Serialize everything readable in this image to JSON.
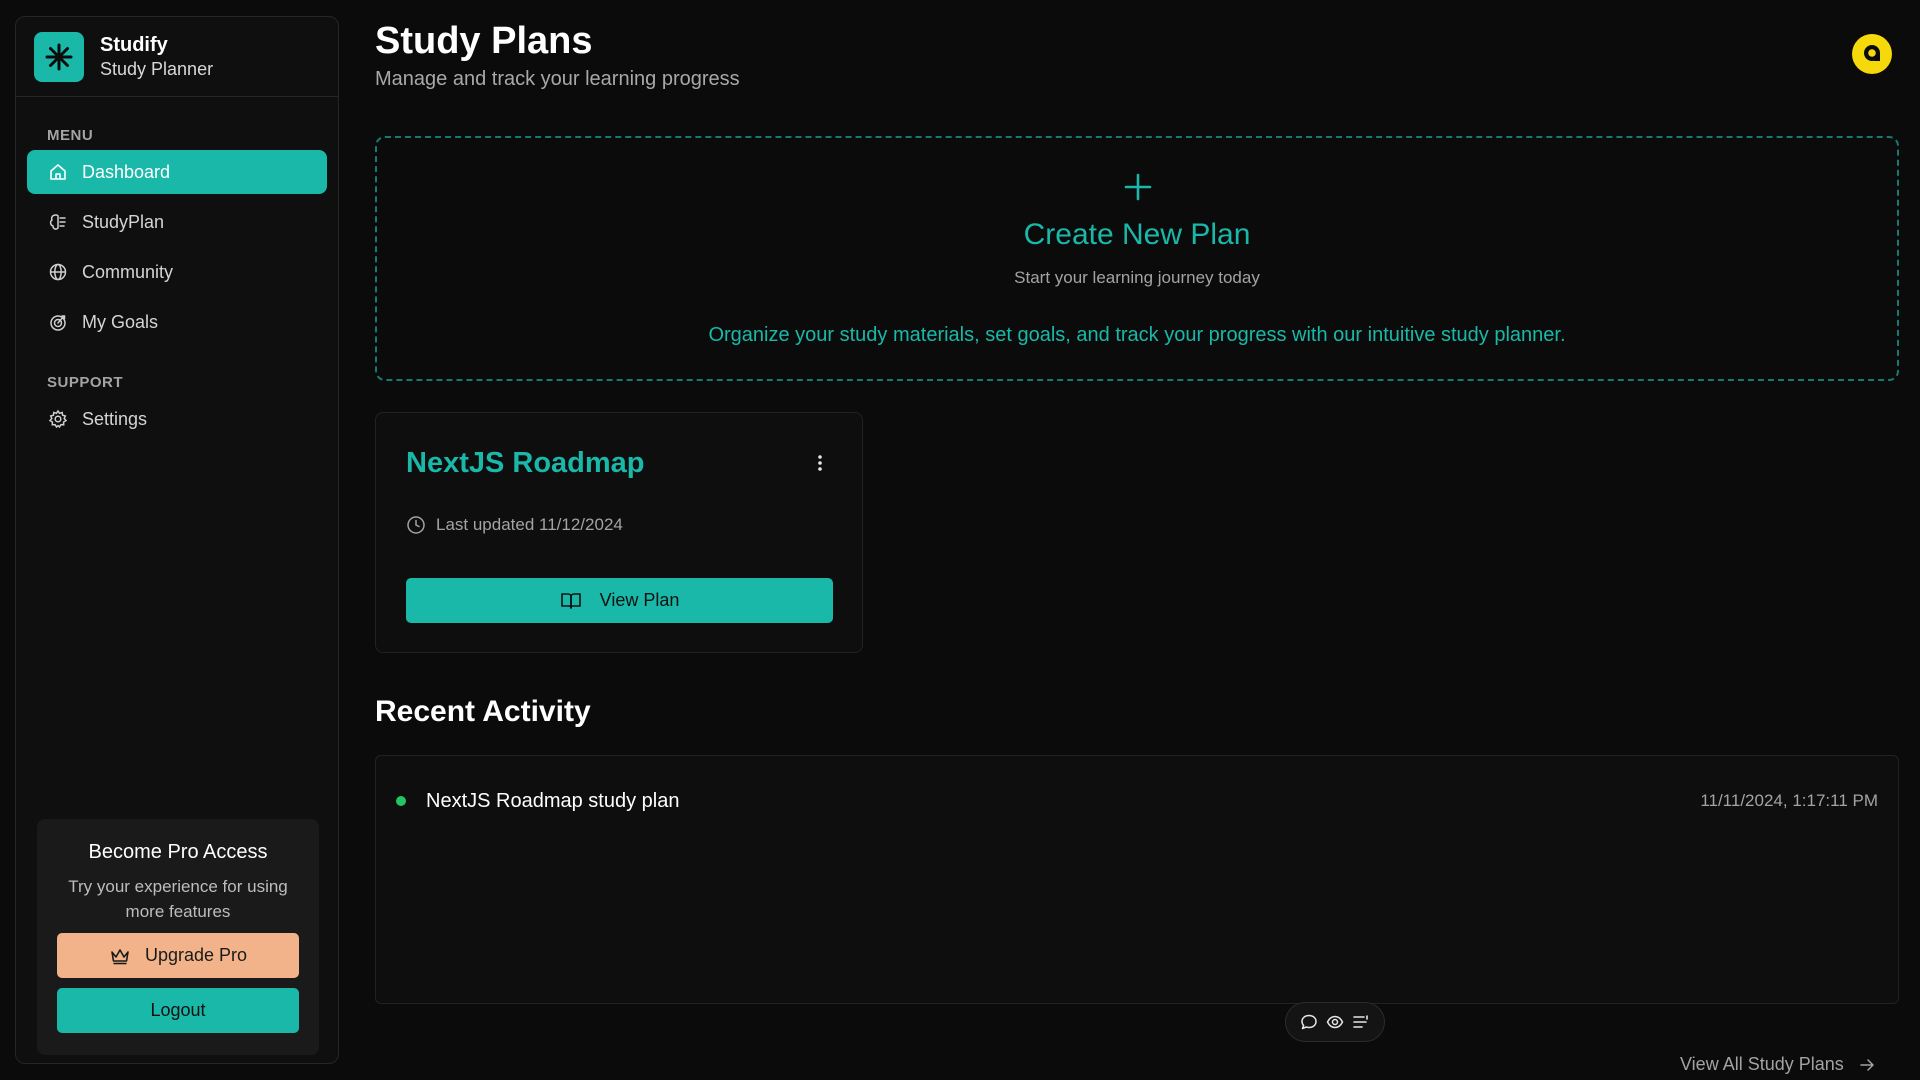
{
  "brand": {
    "title": "Studify",
    "subtitle": "Study Planner",
    "icon": "sparkle-icon",
    "accent": "#19b8a8"
  },
  "sidebar": {
    "menu_label": "MENU",
    "items": [
      {
        "label": "Dashboard",
        "icon": "home-icon",
        "active": true
      },
      {
        "label": "StudyPlan",
        "icon": "brain-icon"
      },
      {
        "label": "Community",
        "icon": "globe-icon"
      },
      {
        "label": "My Goals",
        "icon": "goal-icon"
      }
    ],
    "support_label": "SUPPORT",
    "support_items": [
      {
        "label": "Settings",
        "icon": "gear-icon"
      }
    ],
    "pro": {
      "title": "Become Pro Access",
      "description": "Try your experience for using more features",
      "upgrade_label": "Upgrade Pro",
      "logout_label": "Logout"
    }
  },
  "header": {
    "title": "Study Plans",
    "subtitle": "Manage and track your learning progress"
  },
  "create": {
    "title": "Create New Plan",
    "subtitle": "Start your learning journey today",
    "description": "Organize your study materials, set goals, and track your progress with our intuitive study planner."
  },
  "plans": [
    {
      "title": "NextJS Roadmap",
      "updated": "Last updated 11/12/2024",
      "button_label": "View Plan"
    }
  ],
  "recent": {
    "title": "Recent Activity",
    "items": [
      {
        "text": "NextJS Roadmap study plan",
        "time": "11/11/2024, 1:17:11 PM"
      }
    ],
    "view_all_label": "View All Study Plans"
  }
}
